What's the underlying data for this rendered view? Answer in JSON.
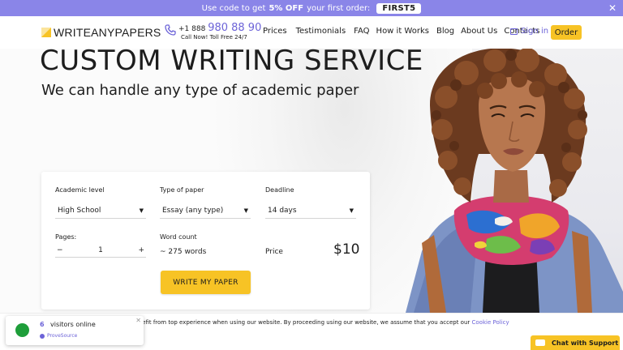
{
  "promo": {
    "text_before": "Use code to get",
    "discount": "5% OFF",
    "text_after": "your first order:",
    "code": "FIRST5",
    "close_glyph": "✕"
  },
  "header": {
    "logo_text": "WRITEANYPAPERS",
    "phone_prefix": "+1 888",
    "phone_number": "980 88 90",
    "phone_sub": "Call Now! Toll Free 24/7",
    "nav": [
      "Prices",
      "Testimonials",
      "FAQ",
      "How it Works",
      "Blog",
      "About Us",
      "Contacts"
    ],
    "sign_in": "Sign in",
    "order": "Order"
  },
  "hero": {
    "title": "CUSTOM WRITING SERVICE",
    "subtitle": "We can handle any type of academic paper"
  },
  "calculator": {
    "academic_level_label": "Academic level",
    "academic_level_value": "High School",
    "paper_type_label": "Type of paper",
    "paper_type_value": "Essay (any type)",
    "deadline_label": "Deadline",
    "deadline_value": "14 days",
    "pages_label": "Pages:",
    "pages_minus": "−",
    "pages_value": "1",
    "pages_plus": "+",
    "word_count_label": "Word count",
    "word_count_value": "~ 275 words",
    "price_label": "Price",
    "price_value": "$10",
    "submit": "WRITE MY PAPER"
  },
  "cookie": {
    "text": "an benefit from top experience when using our website. By proceeding using our website, we assume that you accept our",
    "link": "Cookie Policy"
  },
  "visitors": {
    "count": "6",
    "text": "visitors online",
    "source": "ProveSource",
    "close": "✕"
  },
  "chat": {
    "label": "Chat with Support"
  },
  "colors": {
    "accent": "#6c63d8",
    "yellow": "#f7c325",
    "promo_bg": "#8a85e8",
    "green": "#1e9e3a"
  }
}
